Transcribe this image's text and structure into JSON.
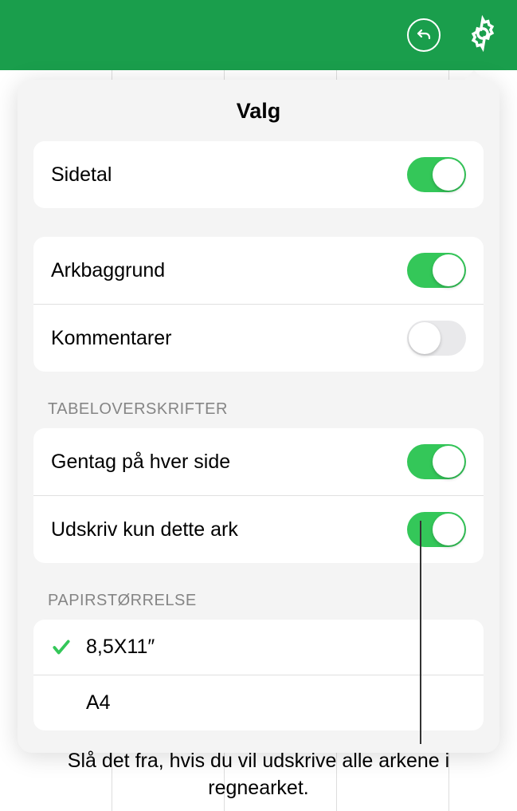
{
  "toolbar": {
    "undo_icon": "undo",
    "settings_icon": "gear"
  },
  "popover": {
    "title": "Valg",
    "section1": {
      "items": [
        {
          "label": "Sidetal",
          "state": "on"
        }
      ]
    },
    "section2": {
      "items": [
        {
          "label": "Arkbaggrund",
          "state": "on"
        },
        {
          "label": "Kommentarer",
          "state": "off"
        }
      ]
    },
    "section3": {
      "header": "TABELOVERSKRIFTER",
      "items": [
        {
          "label": "Gentag på hver side",
          "state": "on"
        },
        {
          "label": "Udskriv kun dette ark",
          "state": "on"
        }
      ]
    },
    "section4": {
      "header": "PAPIRSTØRRELSE",
      "items": [
        {
          "label": "8,5X11″",
          "selected": true
        },
        {
          "label": "A4",
          "selected": false
        }
      ]
    }
  },
  "callout": {
    "text": "Slå det fra, hvis du vil udskrive alle arkene i regnearket."
  }
}
